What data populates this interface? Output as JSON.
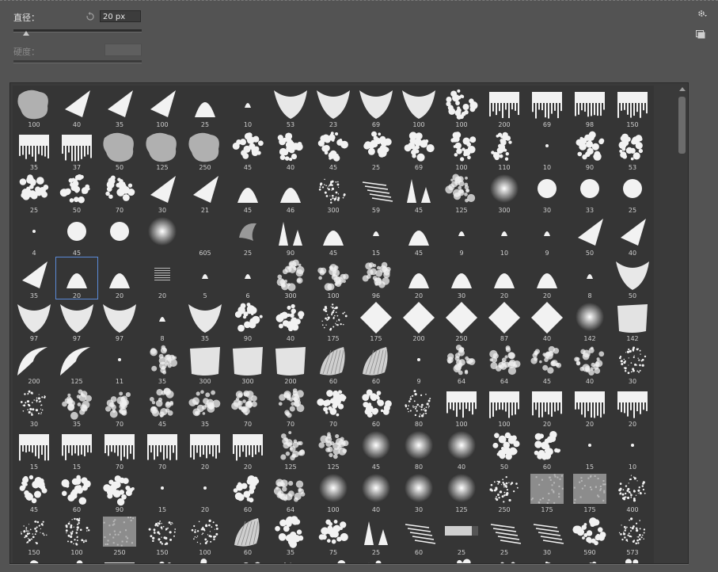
{
  "controls": {
    "size_label": "直径：",
    "size_value": "20 px",
    "hardness_label": "硬度："
  },
  "brushes": [
    {
      "size": "100",
      "shape": "blob"
    },
    {
      "size": "40",
      "shape": "wedge"
    },
    {
      "size": "35",
      "shape": "wedge"
    },
    {
      "size": "100",
      "shape": "wedge"
    },
    {
      "size": "25",
      "shape": "dome"
    },
    {
      "size": "10",
      "shape": "dome-small"
    },
    {
      "size": "53",
      "shape": "vee"
    },
    {
      "size": "23",
      "shape": "vee"
    },
    {
      "size": "69",
      "shape": "vee"
    },
    {
      "size": "100",
      "shape": "vee"
    },
    {
      "size": "100",
      "shape": "tree"
    },
    {
      "size": "200",
      "shape": "grass"
    },
    {
      "size": "69",
      "shape": "grass"
    },
    {
      "size": "98",
      "shape": "grass"
    },
    {
      "size": "150",
      "shape": "grass"
    },
    {
      "size": "35",
      "shape": "grass"
    },
    {
      "size": "37",
      "shape": "grass"
    },
    {
      "size": "50",
      "shape": "blob"
    },
    {
      "size": "125",
      "shape": "blob"
    },
    {
      "size": "250",
      "shape": "blob"
    },
    {
      "size": "45",
      "shape": "tree"
    },
    {
      "size": "40",
      "shape": "tree"
    },
    {
      "size": "45",
      "shape": "tree"
    },
    {
      "size": "25",
      "shape": "tree"
    },
    {
      "size": "69",
      "shape": "tree"
    },
    {
      "size": "100",
      "shape": "tree"
    },
    {
      "size": "110",
      "shape": "tree"
    },
    {
      "size": "10",
      "shape": "dot"
    },
    {
      "size": "90",
      "shape": "tree"
    },
    {
      "size": "53",
      "shape": "tree"
    },
    {
      "size": "25",
      "shape": "tree"
    },
    {
      "size": "50",
      "shape": "tree"
    },
    {
      "size": "70",
      "shape": "tree"
    },
    {
      "size": "30",
      "shape": "wedge"
    },
    {
      "size": "21",
      "shape": "wedge"
    },
    {
      "size": "45",
      "shape": "dome"
    },
    {
      "size": "46",
      "shape": "dome"
    },
    {
      "size": "300",
      "shape": "speckle"
    },
    {
      "size": "59",
      "shape": "streak"
    },
    {
      "size": "45",
      "shape": "spikes"
    },
    {
      "size": "125",
      "shape": "fuzzy"
    },
    {
      "size": "300",
      "shape": "soft"
    },
    {
      "size": "30",
      "shape": "circle"
    },
    {
      "size": "33",
      "shape": "circle"
    },
    {
      "size": "25",
      "shape": "circle"
    },
    {
      "size": "4",
      "shape": "dot"
    },
    {
      "size": "45",
      "shape": "circle"
    },
    {
      "size": "",
      "shape": "circle"
    },
    {
      "size": "",
      "shape": "soft"
    },
    {
      "size": "605",
      "shape": "empty"
    },
    {
      "size": "25",
      "shape": "leaf"
    },
    {
      "size": "90",
      "shape": "spikes"
    },
    {
      "size": "45",
      "shape": "dome"
    },
    {
      "size": "15",
      "shape": "dome-small"
    },
    {
      "size": "45",
      "shape": "dome"
    },
    {
      "size": "9",
      "shape": "dome-small"
    },
    {
      "size": "10",
      "shape": "dome-small"
    },
    {
      "size": "9",
      "shape": "dome-small"
    },
    {
      "size": "50",
      "shape": "wedge"
    },
    {
      "size": "40",
      "shape": "wedge"
    },
    {
      "size": "35",
      "shape": "wedge"
    },
    {
      "size": "20",
      "shape": "dome"
    },
    {
      "size": "20",
      "shape": "dome"
    },
    {
      "size": "20",
      "shape": "lines"
    },
    {
      "size": "5",
      "shape": "dome-small"
    },
    {
      "size": "6",
      "shape": "dome-small"
    },
    {
      "size": "300",
      "shape": "tree-soft"
    },
    {
      "size": "100",
      "shape": "tree-soft"
    },
    {
      "size": "96",
      "shape": "fuzzy"
    },
    {
      "size": "20",
      "shape": "dome"
    },
    {
      "size": "30",
      "shape": "dome"
    },
    {
      "size": "20",
      "shape": "dome"
    },
    {
      "size": "20",
      "shape": "dome"
    },
    {
      "size": "8",
      "shape": "dome-small"
    },
    {
      "size": "50",
      "shape": "vee"
    },
    {
      "size": "97",
      "shape": "vee"
    },
    {
      "size": "97",
      "shape": "vee"
    },
    {
      "size": "97",
      "shape": "vee"
    },
    {
      "size": "8",
      "shape": "dome-small"
    },
    {
      "size": "35",
      "shape": "vee"
    },
    {
      "size": "90",
      "shape": "tree"
    },
    {
      "size": "40",
      "shape": "tree"
    },
    {
      "size": "175",
      "shape": "speckle"
    },
    {
      "size": "175",
      "shape": "diamond"
    },
    {
      "size": "200",
      "shape": "diamond"
    },
    {
      "size": "250",
      "shape": "diamond"
    },
    {
      "size": "87",
      "shape": "diamond"
    },
    {
      "size": "40",
      "shape": "diamond"
    },
    {
      "size": "142",
      "shape": "soft"
    },
    {
      "size": "142",
      "shape": "cloth"
    },
    {
      "size": "200",
      "shape": "feather"
    },
    {
      "size": "125",
      "shape": "feather"
    },
    {
      "size": "11",
      "shape": "dot"
    },
    {
      "size": "35",
      "shape": "fuzzy"
    },
    {
      "size": "300",
      "shape": "cloth"
    },
    {
      "size": "300",
      "shape": "cloth"
    },
    {
      "size": "200",
      "shape": "cloth"
    },
    {
      "size": "60",
      "shape": "bristle"
    },
    {
      "size": "60",
      "shape": "bristle"
    },
    {
      "size": "9",
      "shape": "dot"
    },
    {
      "size": "64",
      "shape": "fuzzy"
    },
    {
      "size": "64",
      "shape": "fuzzy"
    },
    {
      "size": "45",
      "shape": "fuzzy"
    },
    {
      "size": "40",
      "shape": "fuzzy"
    },
    {
      "size": "30",
      "shape": "speckle"
    },
    {
      "size": "30",
      "shape": "speckle"
    },
    {
      "size": "35",
      "shape": "fuzzy"
    },
    {
      "size": "70",
      "shape": "fuzzy"
    },
    {
      "size": "45",
      "shape": "fuzzy"
    },
    {
      "size": "35",
      "shape": "fuzzy"
    },
    {
      "size": "70",
      "shape": "fuzzy"
    },
    {
      "size": "70",
      "shape": "fuzzy"
    },
    {
      "size": "70",
      "shape": "tree"
    },
    {
      "size": "60",
      "shape": "tree"
    },
    {
      "size": "80",
      "shape": "speckle"
    },
    {
      "size": "100",
      "shape": "grass"
    },
    {
      "size": "100",
      "shape": "grass"
    },
    {
      "size": "20",
      "shape": "grass"
    },
    {
      "size": "20",
      "shape": "grass"
    },
    {
      "size": "20",
      "shape": "grass"
    },
    {
      "size": "15",
      "shape": "grass"
    },
    {
      "size": "15",
      "shape": "grass"
    },
    {
      "size": "70",
      "shape": "grass"
    },
    {
      "size": "70",
      "shape": "grass"
    },
    {
      "size": "20",
      "shape": "grass"
    },
    {
      "size": "20",
      "shape": "grass"
    },
    {
      "size": "125",
      "shape": "fuzzy"
    },
    {
      "size": "125",
      "shape": "fuzzy"
    },
    {
      "size": "45",
      "shape": "soft"
    },
    {
      "size": "80",
      "shape": "soft"
    },
    {
      "size": "40",
      "shape": "soft"
    },
    {
      "size": "50",
      "shape": "tree"
    },
    {
      "size": "60",
      "shape": "tree"
    },
    {
      "size": "15",
      "shape": "dot"
    },
    {
      "size": "10",
      "shape": "dot"
    },
    {
      "size": "45",
      "shape": "tree"
    },
    {
      "size": "60",
      "shape": "tree"
    },
    {
      "size": "90",
      "shape": "tree"
    },
    {
      "size": "15",
      "shape": "dot"
    },
    {
      "size": "20",
      "shape": "dot"
    },
    {
      "size": "60",
      "shape": "tree"
    },
    {
      "size": "64",
      "shape": "fuzzy"
    },
    {
      "size": "100",
      "shape": "soft"
    },
    {
      "size": "40",
      "shape": "soft"
    },
    {
      "size": "30",
      "shape": "soft"
    },
    {
      "size": "125",
      "shape": "soft"
    },
    {
      "size": "250",
      "shape": "speckle"
    },
    {
      "size": "175",
      "shape": "texture"
    },
    {
      "size": "175",
      "shape": "texture"
    },
    {
      "size": "400",
      "shape": "speckle"
    },
    {
      "size": "150",
      "shape": "speckle"
    },
    {
      "size": "100",
      "shape": "speckle"
    },
    {
      "size": "250",
      "shape": "texture"
    },
    {
      "size": "150",
      "shape": "speckle"
    },
    {
      "size": "100",
      "shape": "speckle"
    },
    {
      "size": "60",
      "shape": "bristle"
    },
    {
      "size": "35",
      "shape": "tree"
    },
    {
      "size": "75",
      "shape": "tree"
    },
    {
      "size": "25",
      "shape": "spikes"
    },
    {
      "size": "60",
      "shape": "streak"
    },
    {
      "size": "25",
      "shape": "brushtip"
    },
    {
      "size": "25",
      "shape": "streak"
    },
    {
      "size": "30",
      "shape": "streak"
    },
    {
      "size": "590",
      "shape": "tree"
    },
    {
      "size": "573",
      "shape": "speckle"
    },
    {
      "size": "",
      "shape": "tree"
    },
    {
      "size": "",
      "shape": "tree"
    },
    {
      "size": "",
      "shape": "grass"
    },
    {
      "size": "",
      "shape": "tree"
    },
    {
      "size": "",
      "shape": "tree"
    },
    {
      "size": "",
      "shape": "tree"
    },
    {
      "size": "",
      "shape": "speckle"
    },
    {
      "size": "",
      "shape": "tree"
    },
    {
      "size": "",
      "shape": "tree"
    },
    {
      "size": "",
      "shape": "tree"
    },
    {
      "size": "",
      "shape": "tree"
    },
    {
      "size": "",
      "shape": "tree"
    },
    {
      "size": "",
      "shape": "speckle"
    },
    {
      "size": "",
      "shape": "tree"
    },
    {
      "size": "",
      "shape": "tree"
    }
  ]
}
